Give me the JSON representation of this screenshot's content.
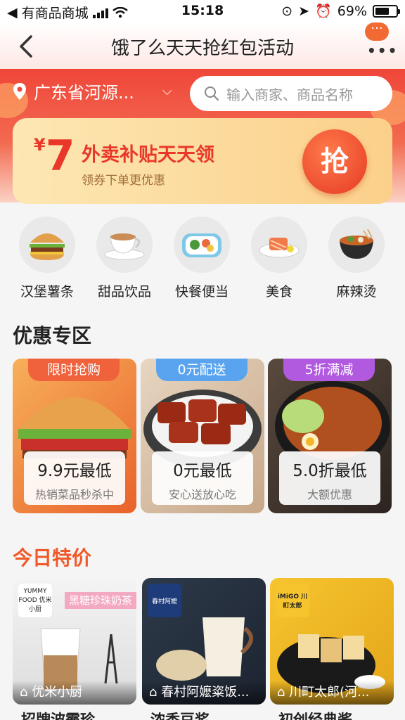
{
  "status": {
    "carrier": "有商品商城",
    "time": "15:18",
    "battery": "69%",
    "battery_level": 0.69
  },
  "nav": {
    "title": "饿了么天天抢红包活动"
  },
  "location": {
    "city": "广东省河源..."
  },
  "search": {
    "placeholder": "输入商家、商品名称"
  },
  "coupon": {
    "yen": "¥",
    "amount": "7",
    "headline": "外卖补贴天天领",
    "subtitle": "领券下单更优惠",
    "button": "抢"
  },
  "categories": [
    {
      "label": "汉堡薯条",
      "icon": "burger-icon"
    },
    {
      "label": "甜品饮品",
      "icon": "coffee-icon"
    },
    {
      "label": "快餐便当",
      "icon": "bento-icon"
    },
    {
      "label": "美食",
      "icon": "salmon-icon"
    },
    {
      "label": "麻辣烫",
      "icon": "hotpot-icon"
    }
  ],
  "promo_section": {
    "title": "优惠专区"
  },
  "promos": [
    {
      "tag": "限时抢购",
      "title": "9.9元最低",
      "subtitle": "热销菜品秒杀中",
      "tag_color": "#f0623b"
    },
    {
      "tag": "0元配送",
      "title": "0元最低",
      "subtitle": "安心送放心吃",
      "tag_color": "#5aa4ef"
    },
    {
      "tag": "5折满减",
      "title": "5.0折最低",
      "subtitle": "大额优惠",
      "tag_color": "#b15ae0"
    }
  ],
  "today_section": {
    "title": "今日特价"
  },
  "today": [
    {
      "shop": "优米小厨",
      "ribbon": "黑糖珍珠奶茶",
      "dish": "招牌波霸珍",
      "logo_text": "YUMMY FOOD 优米小厨"
    },
    {
      "shop": "春村阿嬷粢饭...",
      "ribbon": "",
      "dish": "浓香豆浆",
      "logo_text": "春村阿嬷"
    },
    {
      "shop": "川町太郎(河...",
      "ribbon": "",
      "dish": "初创经典酱",
      "logo_text": "iMiGO 川町太郎"
    }
  ]
}
